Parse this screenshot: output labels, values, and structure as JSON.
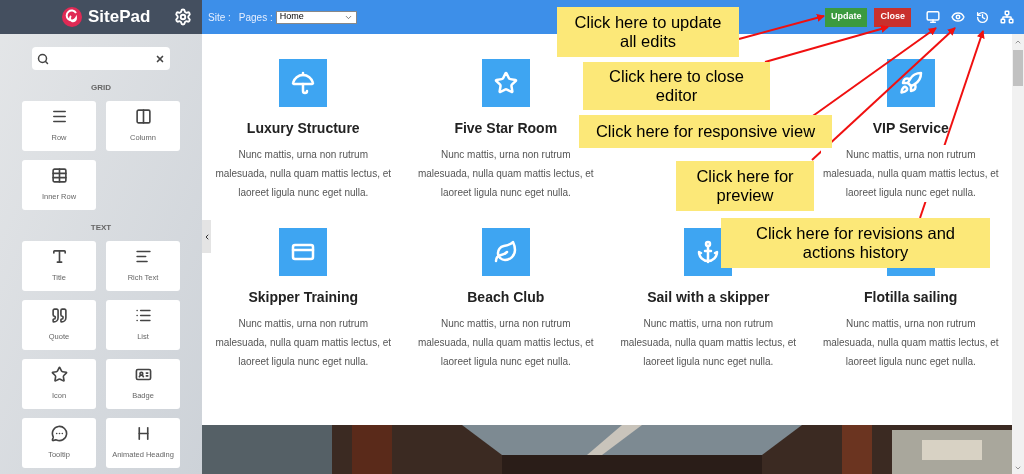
{
  "sidebar": {
    "brand": "SitePad",
    "sections": [
      {
        "title": "GRID",
        "items": [
          {
            "label": "Row",
            "kind": "row"
          },
          {
            "label": "Column",
            "kind": "column"
          },
          {
            "label": "Inner Row",
            "kind": "innerrow"
          }
        ]
      },
      {
        "title": "TEXT",
        "items": [
          {
            "label": "Title",
            "kind": "title"
          },
          {
            "label": "Rich Text",
            "kind": "richtext"
          },
          {
            "label": "Quote",
            "kind": "quote"
          },
          {
            "label": "List",
            "kind": "list"
          },
          {
            "label": "Icon",
            "kind": "icon"
          },
          {
            "label": "Badge",
            "kind": "badge"
          },
          {
            "label": "Tooltip",
            "kind": "tooltip"
          },
          {
            "label": "Animated Heading",
            "kind": "heading"
          }
        ]
      }
    ]
  },
  "topbar": {
    "site_label": "Site :",
    "pages_label": "Pages :",
    "page_select": "Home",
    "buttons": [
      {
        "label": "Update",
        "kind": "update"
      },
      {
        "label": "Close",
        "kind": "close"
      }
    ]
  },
  "card_rows": [
    [
      {
        "kind": "umbrella",
        "title": "Luxury Structure",
        "text": "Nunc mattis, urna non rutrum malesuada, nulla quam mattis lectus, et laoreet ligula nunc eget nulla."
      },
      {
        "kind": "star",
        "title": "Five Star Room",
        "text": "Nunc mattis, urna non rutrum malesuada, nulla quam mattis lectus, et laoreet ligula nunc eget nulla."
      },
      {
        "kind": "covered"
      },
      {
        "kind": "rocket",
        "title": "VIP Service",
        "text": "Nunc mattis, urna non rutrum malesuada, nulla quam mattis lectus, et laoreet ligula nunc eget nulla."
      }
    ],
    [
      {
        "kind": "card",
        "title": "Skipper Training",
        "text": "Nunc mattis, urna non rutrum malesuada, nulla quam mattis lectus, et laoreet ligula nunc eget nulla."
      },
      {
        "kind": "leaf",
        "title": "Beach Club",
        "text": "Nunc mattis, urna non rutrum malesuada, nulla quam mattis lectus, et laoreet ligula nunc eget nulla."
      },
      {
        "kind": "anchor",
        "title": "Sail with a skipper",
        "text": "Nunc mattis, urna non rutrum malesuada, nulla quam mattis lectus, et laoreet ligula nunc eget nulla."
      },
      {
        "kind": "blank",
        "title": "Flotilla sailing",
        "text": "Nunc mattis, urna non rutrum malesuada, nulla quam mattis lectus, et laoreet ligula nunc eget nulla."
      }
    ]
  ],
  "callouts": [
    {
      "text": "Click here to update all edits"
    },
    {
      "text": "Click here to close editor"
    },
    {
      "text": "Click here for responsive view"
    },
    {
      "text": "Click here for preview"
    },
    {
      "text": "Click here for revisions and actions history"
    }
  ]
}
